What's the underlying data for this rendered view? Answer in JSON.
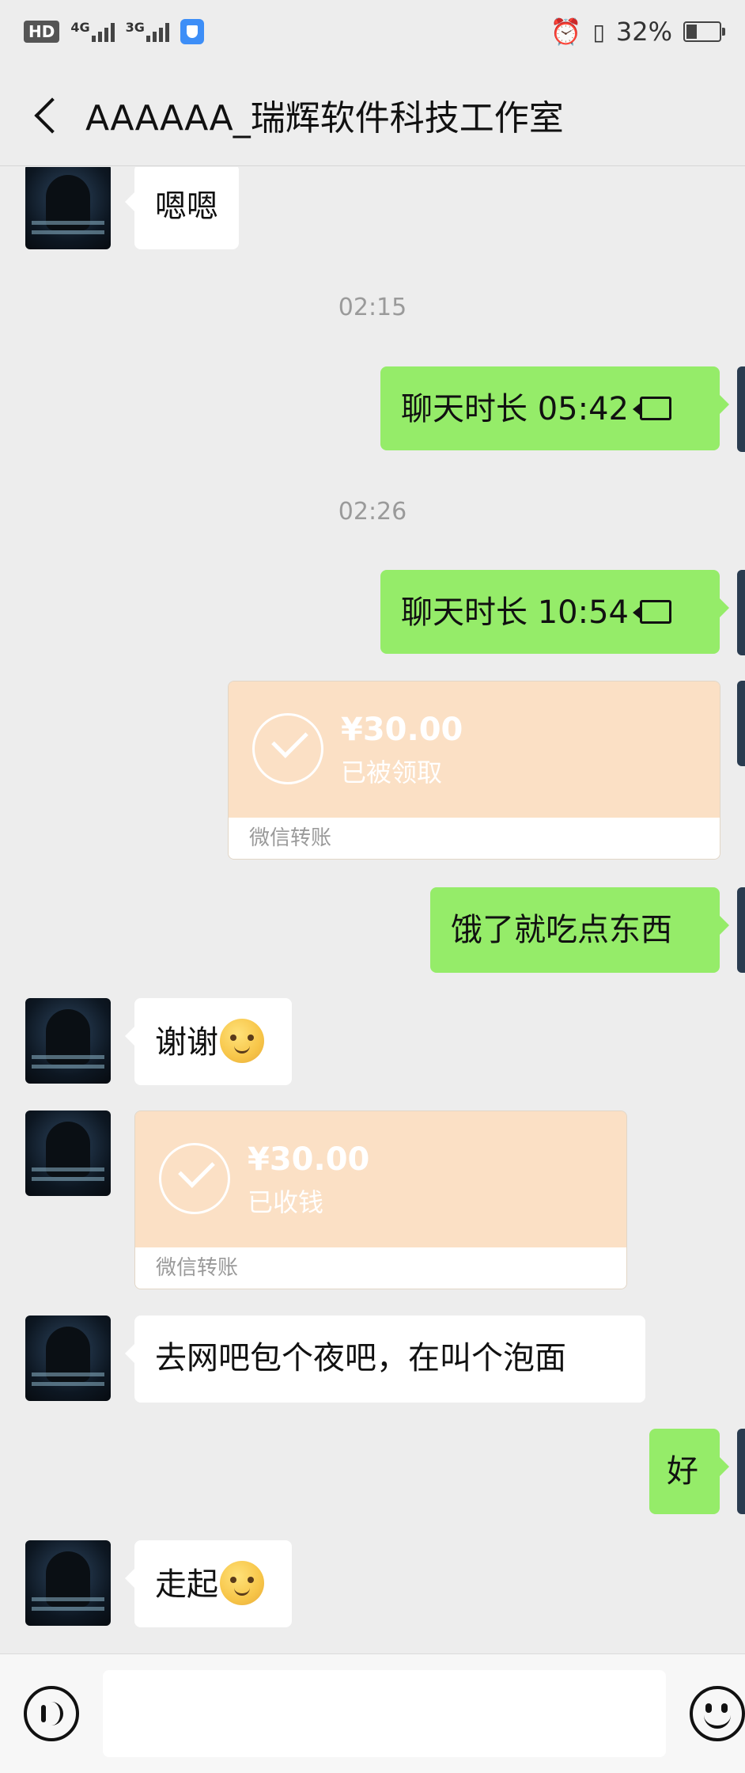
{
  "status_bar": {
    "hd": "HD",
    "net1": "4G",
    "net2": "3G",
    "battery": "32%",
    "battery_level": 0.32
  },
  "header": {
    "title": "AAAAAA_瑞辉软件科技工作室",
    "back_icon": "chevron-left-icon"
  },
  "chat": {
    "msg1": "嗯嗯",
    "time1": "02:15",
    "call1": "聊天时长 05:42",
    "time2": "02:26",
    "call2": "聊天时长 10:54",
    "transfer1": {
      "amount": "¥30.00",
      "status": "已被领取",
      "label": "微信转账"
    },
    "msg2": "饿了就吃点东西",
    "msg3": "谢谢",
    "transfer2": {
      "amount": "¥30.00",
      "status": "已收钱",
      "label": "微信转账"
    },
    "msg4": "去网吧包个夜吧，在叫个泡面",
    "msg5": "好",
    "msg6": "走起"
  },
  "input_bar": {
    "voice_icon": "voice-icon",
    "emoji_icon": "emoji-icon",
    "placeholder": ""
  },
  "colors": {
    "background": "#ededed",
    "outgoing_bubble": "#95ec69",
    "incoming_bubble": "#ffffff",
    "transfer_card": "#fbe0c5"
  }
}
